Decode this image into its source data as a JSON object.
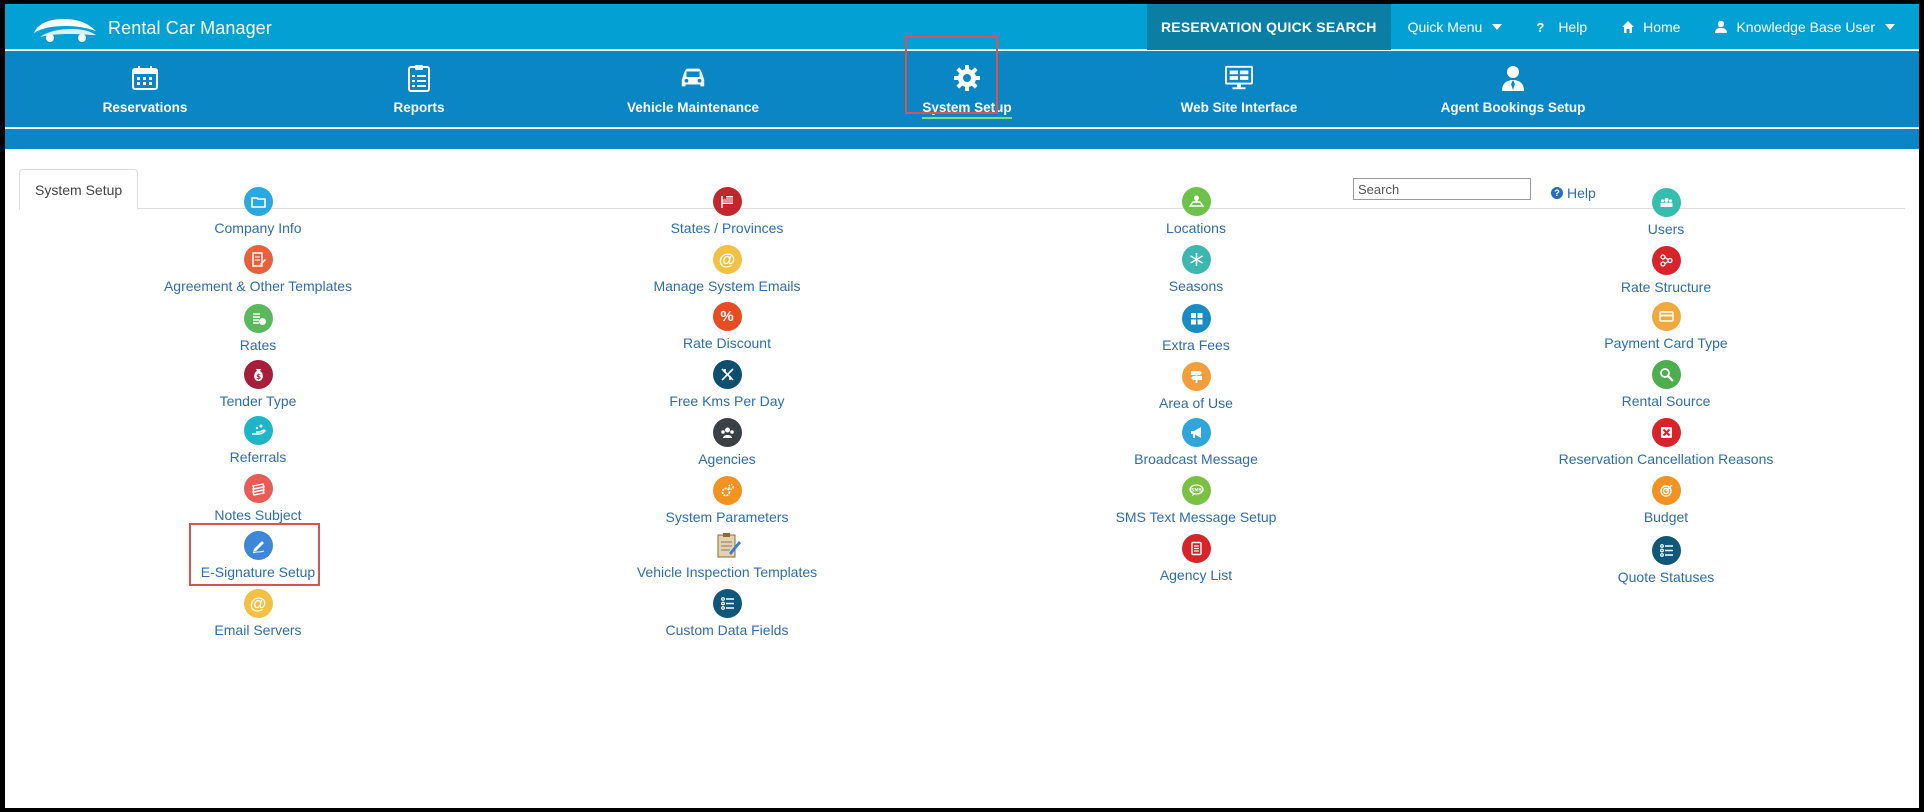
{
  "topbar": {
    "brand": "Rental Car Manager",
    "quick_search": "RESERVATION QUICK SEARCH",
    "quick_menu": "Quick Menu",
    "help": "Help",
    "home": "Home",
    "user": "Knowledge Base User"
  },
  "modules": [
    {
      "label": "Reservations",
      "icon": "calendar-icon"
    },
    {
      "label": "Reports",
      "icon": "clipboard-icon"
    },
    {
      "label": "Vehicle Maintenance",
      "icon": "car-icon"
    },
    {
      "label": "System Setup",
      "icon": "gear-icon",
      "active": true
    },
    {
      "label": "Web Site Interface",
      "icon": "monitor-icon"
    },
    {
      "label": "Agent Bookings Setup",
      "icon": "agent-icon"
    }
  ],
  "page": {
    "tab": "System Setup",
    "search_placeholder": "Search",
    "help": "Help"
  },
  "columns": [
    [
      {
        "label": "Company Info",
        "color": "#29a9e0",
        "icon": "folder-icon"
      },
      {
        "label": "Agreement & Other Templates",
        "color": "#e8603c",
        "icon": "document-edit-icon"
      },
      {
        "label": "Rates",
        "color": "#5cb85c",
        "icon": "rates-icon"
      },
      {
        "label": "Tender Type",
        "color": "#a61e3a",
        "icon": "money-bag-icon"
      },
      {
        "label": "Referrals",
        "color": "#1fb5c9",
        "icon": "hand-icon"
      },
      {
        "label": "Notes Subject",
        "color": "#e85b57",
        "icon": "notes-icon"
      },
      {
        "label": "E-Signature Setup",
        "color": "#3d86d8",
        "icon": "pen-icon"
      },
      {
        "label": "Email Servers",
        "color": "#f2c042",
        "icon": "at-icon"
      }
    ],
    [
      {
        "label": "States / Provinces",
        "color": "#c1272d",
        "icon": "flag-icon"
      },
      {
        "label": "Manage System Emails",
        "color": "#f2c042",
        "icon": "at-icon"
      },
      {
        "label": "Rate Discount",
        "color": "#e84c22",
        "icon": "percent-icon"
      },
      {
        "label": "Free Kms Per Day",
        "color": "#0f4e6e",
        "icon": "road-icon"
      },
      {
        "label": "Agencies",
        "color": "#3a4046",
        "icon": "group-icon"
      },
      {
        "label": "System Parameters",
        "color": "#f29221",
        "icon": "gears-icon"
      },
      {
        "label": "Vehicle Inspection Templates",
        "color": "#c48a3c",
        "icon": "inspection-icon"
      },
      {
        "label": "Custom Data Fields",
        "color": "#10577a",
        "icon": "list-icon"
      }
    ],
    [
      {
        "label": "Locations",
        "color": "#6cc24a",
        "icon": "map-icon"
      },
      {
        "label": "Seasons",
        "color": "#3cb7b0",
        "icon": "snowflake-icon"
      },
      {
        "label": "Extra Fees",
        "color": "#1a8cc4",
        "icon": "grid-icon"
      },
      {
        "label": "Area of Use",
        "color": "#f29e3c",
        "icon": "signpost-icon"
      },
      {
        "label": "Broadcast Message",
        "color": "#2ea6d9",
        "icon": "megaphone-icon"
      },
      {
        "label": "SMS Text Message Setup",
        "color": "#7ac143",
        "icon": "sms-icon"
      },
      {
        "label": "Agency List",
        "color": "#d8232a",
        "icon": "page-list-icon"
      }
    ],
    [
      {
        "label": "Users",
        "color": "#37bcb0",
        "icon": "users-icon"
      },
      {
        "label": "Rate Structure",
        "color": "#d8232a",
        "icon": "structure-icon"
      },
      {
        "label": "Payment Card Type",
        "color": "#f2a93c",
        "icon": "card-icon"
      },
      {
        "label": "Rental Source",
        "color": "#4cae4c",
        "icon": "magnifier-icon"
      },
      {
        "label": "Reservation Cancellation Reasons",
        "color": "#d8232a",
        "icon": "cancel-icon"
      },
      {
        "label": "Budget",
        "color": "#f29221",
        "icon": "target-icon"
      },
      {
        "label": "Quote Statuses",
        "color": "#10577a",
        "icon": "list-icon"
      }
    ]
  ]
}
